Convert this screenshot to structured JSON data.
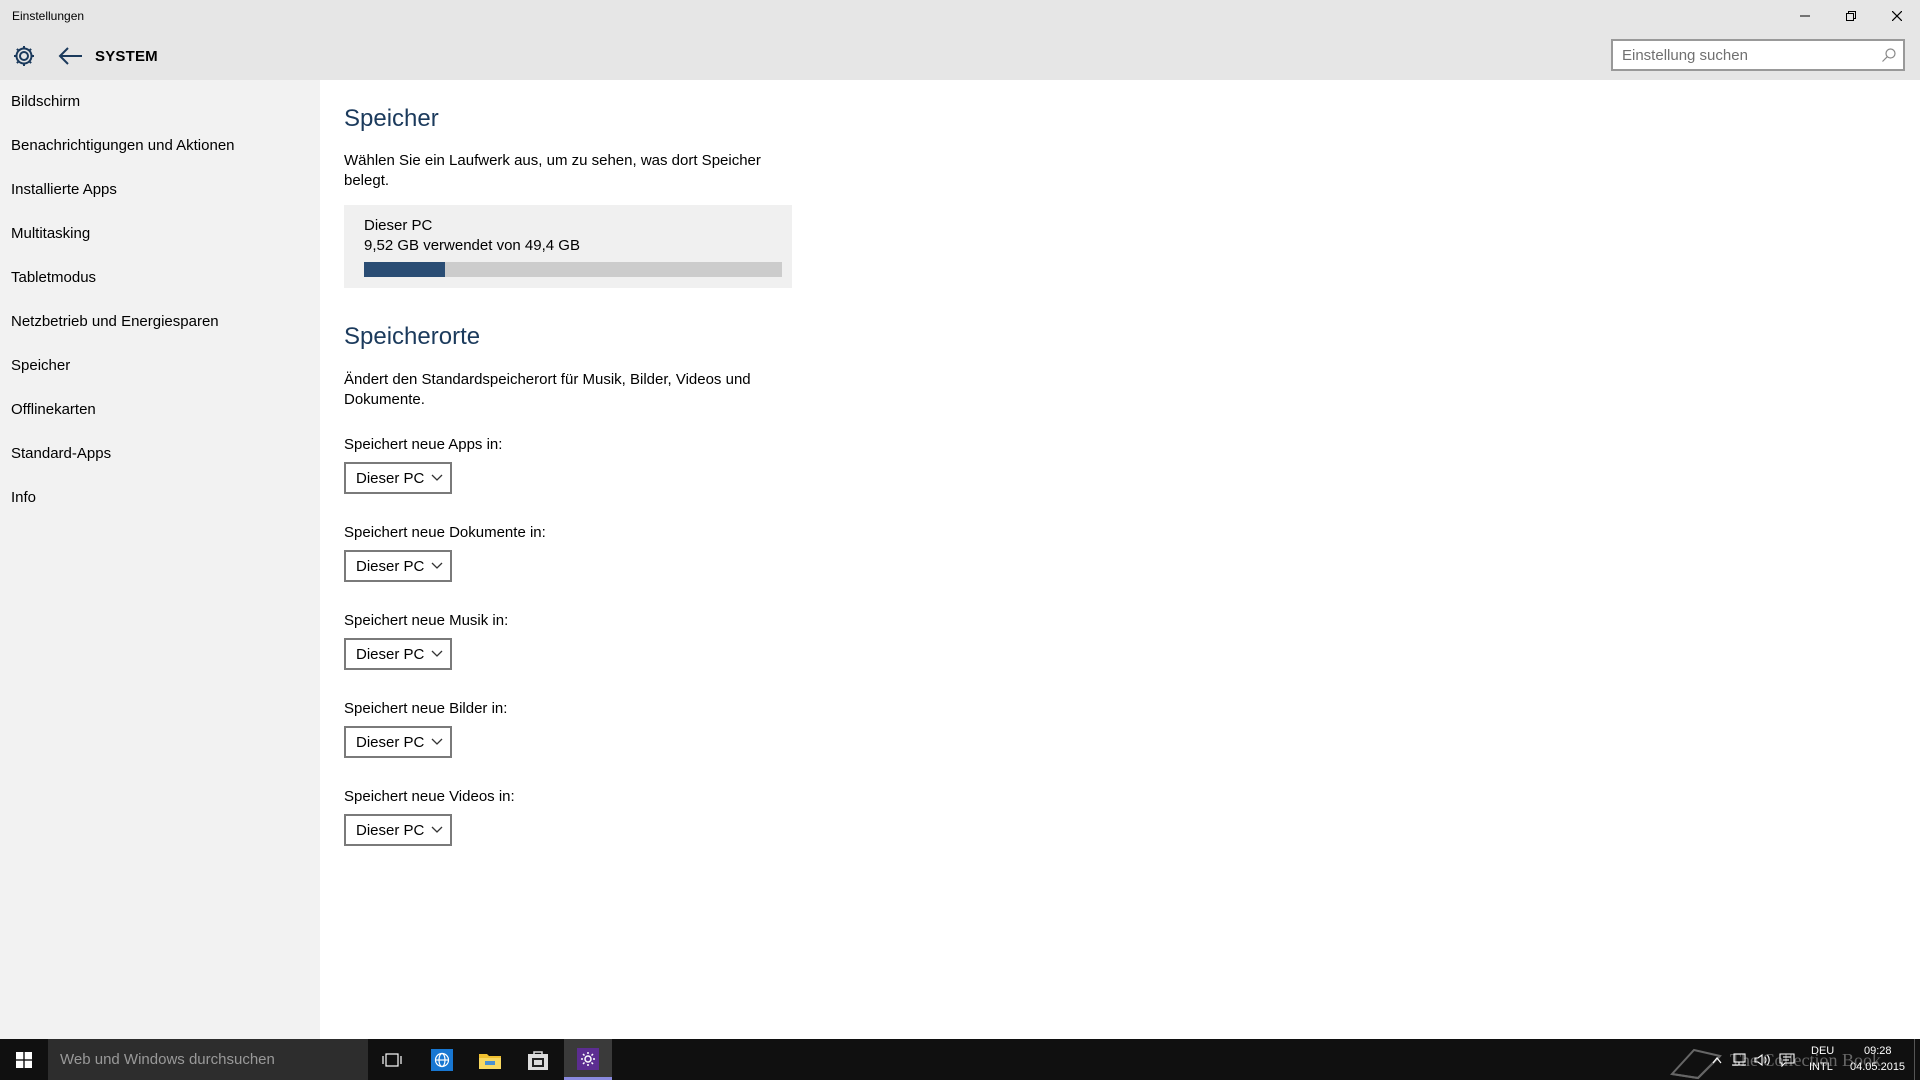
{
  "window": {
    "title": "Einstellungen",
    "controls": [
      "minimize",
      "restore",
      "close"
    ]
  },
  "header": {
    "icon": "gear-icon",
    "back_icon": "arrow-left-icon",
    "title": "SYSTEM",
    "search_placeholder": "Einstellung suchen",
    "search_value": ""
  },
  "sidebar": {
    "items": [
      {
        "label": "Bildschirm"
      },
      {
        "label": "Benachrichtigungen und Aktionen"
      },
      {
        "label": "Installierte Apps"
      },
      {
        "label": "Multitasking"
      },
      {
        "label": "Tabletmodus"
      },
      {
        "label": "Netzbetrieb und Energiesparen"
      },
      {
        "label": "Speicher",
        "selected": true
      },
      {
        "label": "Offlinekarten"
      },
      {
        "label": "Standard-Apps"
      },
      {
        "label": "Info"
      }
    ]
  },
  "main": {
    "storage": {
      "heading": "Speicher",
      "description": "Wählen Sie ein Laufwerk aus, um zu sehen, was dort Speicher belegt.",
      "drive": {
        "name": "Dieser PC",
        "usage_text": "9,52 GB verwendet von 49,4 GB",
        "used_fraction": 0.193
      }
    },
    "locations": {
      "heading": "Speicherorte",
      "description": "Ändert den Standardspeicherort für Musik, Bilder, Videos und Dokumente.",
      "settings": [
        {
          "label": "Speichert neue Apps in:",
          "value": "Dieser PC"
        },
        {
          "label": "Speichert neue Dokumente in:",
          "value": "Dieser PC"
        },
        {
          "label": "Speichert neue Musik in:",
          "value": "Dieser PC"
        },
        {
          "label": "Speichert neue Bilder in:",
          "value": "Dieser PC"
        },
        {
          "label": "Speichert neue Videos in:",
          "value": "Dieser PC"
        }
      ]
    }
  },
  "taskbar": {
    "search_placeholder": "Web und Windows durchsuchen",
    "apps": [
      "task-view-icon",
      "browser-icon",
      "file-explorer-icon",
      "store-icon",
      "settings-icon"
    ],
    "active_app": "settings-icon",
    "language_top": "DEU",
    "language_bottom": "INTL",
    "time": "09:28",
    "date": "04.05.2015",
    "watermark": "The Collection Book"
  },
  "colors": {
    "accent_heading": "#1b3a5c",
    "progress_fill": "#2a4d74",
    "sidebar_bg": "#f2f2f2",
    "titlebar_bg": "#e6e6e6",
    "taskbar_bg": "#101010"
  }
}
